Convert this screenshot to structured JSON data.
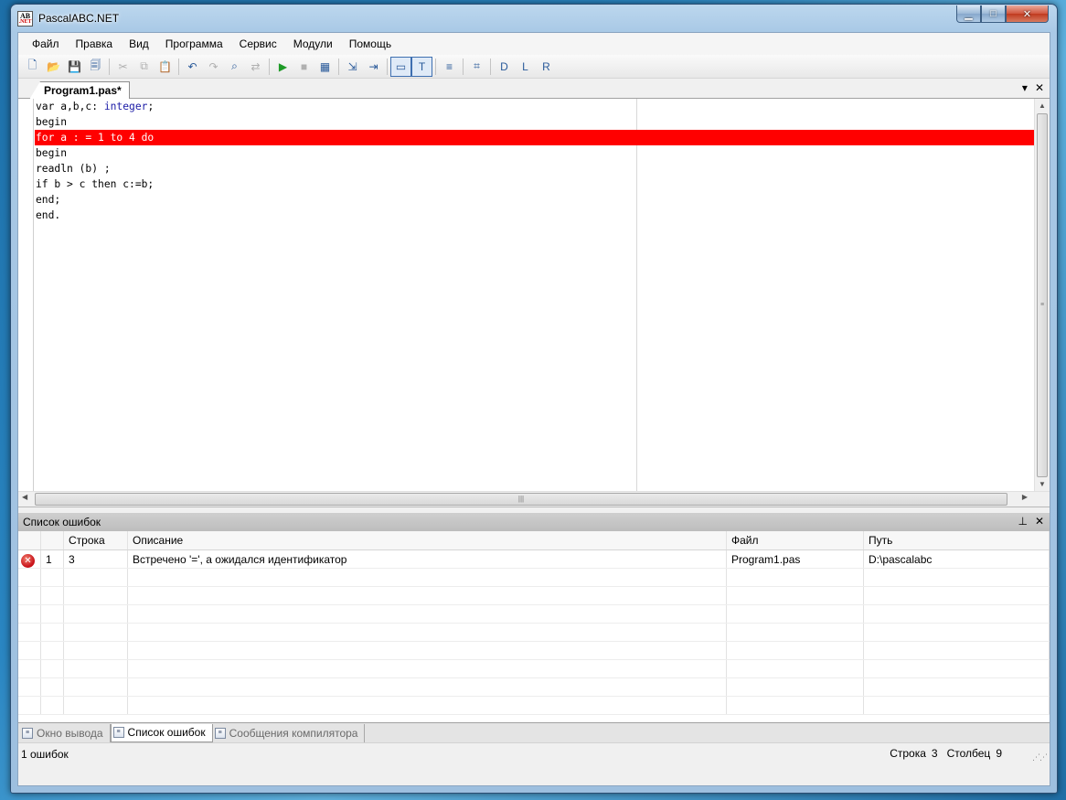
{
  "window": {
    "title": "PascalABC.NET",
    "icon_text_top": "AB",
    "icon_text_bottom": ".NET",
    "minimize": "▁",
    "maximize": "□",
    "close": "✕"
  },
  "menu": [
    "Файл",
    "Правка",
    "Вид",
    "Программа",
    "Сервис",
    "Модули",
    "Помощь"
  ],
  "toolbar": {
    "groups": [
      [
        "new-file-icon",
        "open-folder-icon",
        "save-icon",
        "save-all-icon"
      ],
      [
        "cut-icon",
        "copy-icon",
        "paste-icon"
      ],
      [
        "undo-icon",
        "redo-icon",
        "find-icon",
        "replace-icon"
      ],
      [
        "run-icon",
        "stop-icon",
        "compile-icon"
      ],
      [
        "step-into-icon",
        "step-over-icon"
      ],
      [
        "console-icon",
        "text-mode-icon"
      ],
      [
        "format-icon"
      ],
      [
        "code-template-icon"
      ],
      [
        "debug-d-icon",
        "debug-l-icon",
        "debug-r-icon"
      ]
    ],
    "active": [
      "console-icon",
      "text-mode-icon"
    ],
    "disabled": [
      "cut-icon",
      "copy-icon",
      "redo-icon",
      "stop-icon",
      "replace-icon"
    ]
  },
  "editor": {
    "tab_label": "Program1.pas*",
    "tab_menu_icon": "▾",
    "tab_close_icon": "✕",
    "lines": [
      {
        "text": "var a,b,c: ",
        "kw": "integer",
        "tail": ";"
      },
      {
        "text": "begin"
      },
      {
        "text": "for a : = 1 to 4 do",
        "error": true
      },
      {
        "text": "begin"
      },
      {
        "text": "readln (b) ;"
      },
      {
        "text": "if b > c then c:=b;"
      },
      {
        "text": "end;"
      },
      {
        "text": "end."
      }
    ]
  },
  "error_panel": {
    "title": "Список ошибок",
    "pin_icon": "📌",
    "close_icon": "✕",
    "columns": [
      "",
      "",
      "Строка",
      "Описание",
      "Файл",
      "Путь"
    ],
    "rows": [
      {
        "num": "1",
        "line": "3",
        "description": "Встречено '=', а ожидался идентификатор",
        "file": "Program1.pas",
        "path": "D:\\pascalabc"
      }
    ],
    "empty_rows": 8
  },
  "bottom_tabs": [
    {
      "label": "Окно вывода",
      "active": false
    },
    {
      "label": "Список ошибок",
      "active": true
    },
    {
      "label": "Сообщения компилятора",
      "active": false
    }
  ],
  "status": {
    "left": "1 ошибок",
    "line_label": "Строка",
    "line_value": "3",
    "col_label": "Столбец",
    "col_value": "9"
  }
}
